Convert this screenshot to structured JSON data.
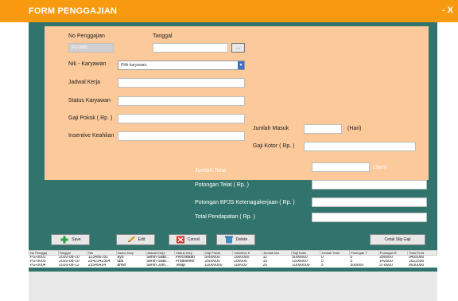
{
  "window": {
    "title": "FORM PENGGAJIAN",
    "controls": "- X"
  },
  "form": {
    "no_penggajian_label": "No Penggajian",
    "no_penggajian_value": "PG-0005",
    "tanggal_label": "Tanggal",
    "tanggal_value": "",
    "date_button": "...",
    "nik_label": "Nik - Karyawan",
    "nik_value": "Pilih karyawan.",
    "jadwal_label": "Jadwal Kerja",
    "status_label": "Status Karyawan",
    "gaji_pokok_label": "Gaji Pokok ( Rp. )",
    "insentive_label": "Insentive Keahlian",
    "jumlah_masuk_label": "Jumlah Masuk",
    "hari_label": "(Hari)",
    "gaji_kotor_label": "Gaji Kotor ( Rp. )"
  },
  "summary": {
    "jumlah_telat_label": "Jumlah Telat",
    "jam_label": "(Jam)",
    "potongan_telat_label": "Potongan Telat ( Rp. )",
    "potongan_bpjs_label": "Potongan BPJS Ketenagakerjaan ( Rp. )",
    "total_label": "Total Pendapatan ( Rp. )"
  },
  "buttons": {
    "save": "Save",
    "edit": "Edit",
    "cancel": "Cancel",
    "delete": "Delete",
    "print": "Cetak Slip Gaji"
  },
  "table": {
    "headers": [
      "No Penggaj",
      "Tanggal",
      "Nik",
      "Nama Kary",
      "Jadwal Kerja",
      "Status Kary",
      "Gaji Pokok",
      "Insentive K",
      "Jumlah Ma",
      "Gaji Kotor",
      "Jumlah Telat",
      "Potongan T",
      "Potongan B",
      "Total Pend"
    ],
    "rows": [
      [
        "PG-0001",
        "2020-08-10",
        "123456782",
        "ayu",
        "Senin-Sabt...",
        "Percobaan",
        "5000000",
        "1000000",
        "11",
        "5000000",
        "0",
        "0",
        "280000",
        "3455000"
      ],
      [
        "PG-0003",
        "2020-08-10",
        "2342342354",
        "lala",
        "Senin-Sabt...",
        "Probitioner",
        "2500000",
        "100000",
        "15",
        "1500000",
        "0",
        "0",
        "142500",
        "1622500"
      ],
      [
        "PG-0004",
        "2020-08-12",
        "23545434",
        "amel",
        "Senin-Jum...",
        "Tetap",
        "10000000",
        "100000",
        "20",
        "10000000",
        "5",
        "500000",
        "570000",
        "9630000"
      ]
    ]
  },
  "colors": {
    "titlebar": "#f89a0f",
    "body": "#31746d",
    "form_panel": "#fbc99a"
  },
  "icons": {
    "save": "plus-icon",
    "edit": "pencil-icon",
    "cancel": "x-icon",
    "delete": "trash-icon",
    "date": "calendar-icon"
  }
}
